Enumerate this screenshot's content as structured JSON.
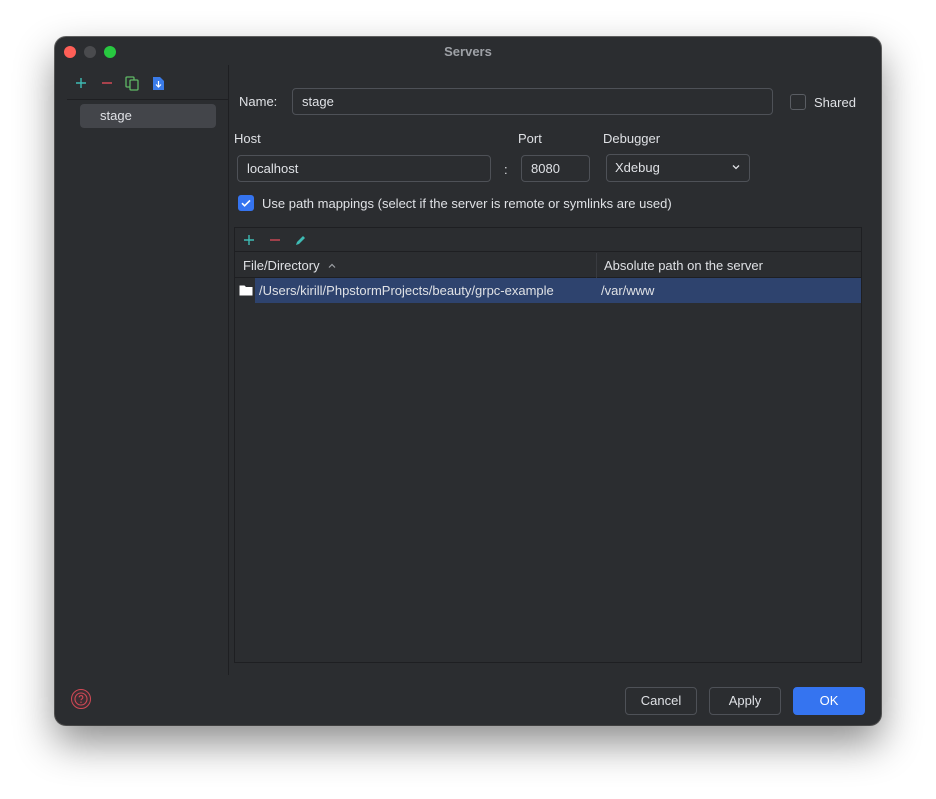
{
  "window": {
    "title": "Servers"
  },
  "left_toolbar": {
    "icons": [
      "add-icon",
      "remove-icon",
      "copy-icon",
      "import-icon"
    ]
  },
  "servers": [
    {
      "name": "stage"
    }
  ],
  "form": {
    "name_label": "Name:",
    "name_value": "stage",
    "shared_label": "Shared",
    "shared_checked": false,
    "host_label": "Host",
    "host_value": "localhost",
    "port_separator": ":",
    "port_label": "Port",
    "port_value": "8080",
    "debugger_label": "Debugger",
    "debugger_value": "Xdebug",
    "path_mappings_label": "Use path mappings (select if the server is remote or symlinks are used)",
    "path_mappings_checked": true
  },
  "mappings": {
    "toolbar_icons": [
      "add-icon",
      "remove-icon",
      "edit-icon"
    ],
    "columns": {
      "file": "File/Directory",
      "absolute": "Absolute path on the server"
    },
    "rows": [
      {
        "file": "/Users/kirill/PhpstormProjects/beauty/grpc-example",
        "absolute": "/var/www"
      }
    ]
  },
  "buttons": {
    "cancel": "Cancel",
    "apply": "Apply",
    "ok": "OK"
  },
  "colors": {
    "accent": "#3574f0",
    "add_green": "#3ebbb4",
    "remove_red": "#d14955",
    "copy_green": "#5fb865",
    "selection": "#2e436e"
  }
}
